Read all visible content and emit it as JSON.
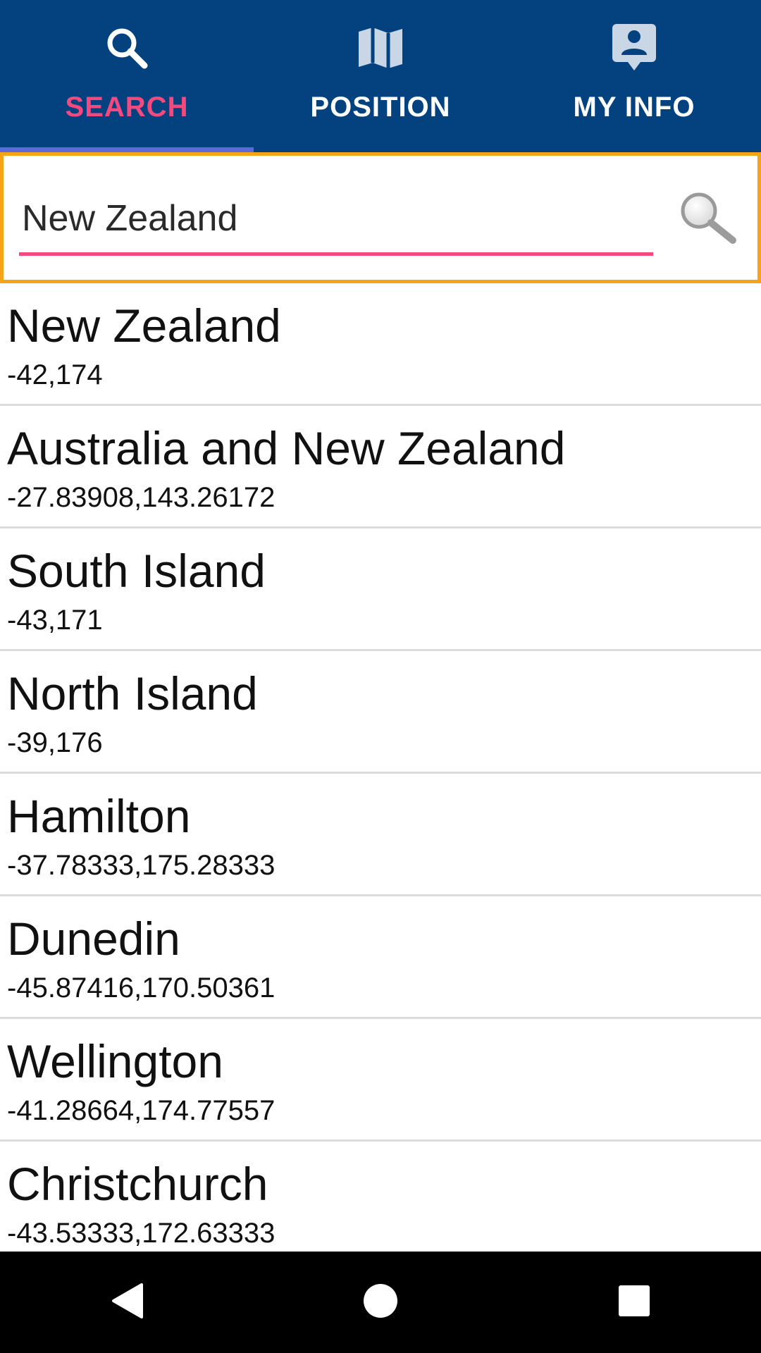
{
  "tabs": [
    {
      "label": "SEARCH",
      "icon": "search-icon",
      "active": true
    },
    {
      "label": "POSITION",
      "icon": "map-icon",
      "active": false
    },
    {
      "label": "MY INFO",
      "icon": "contact-card-icon",
      "active": false
    }
  ],
  "search": {
    "value": "New Zealand",
    "button_icon": "magnifier-icon"
  },
  "results": [
    {
      "name": "New Zealand",
      "coords": "-42,174"
    },
    {
      "name": "Australia and New Zealand",
      "coords": "-27.83908,143.26172"
    },
    {
      "name": "South Island",
      "coords": "-43,171"
    },
    {
      "name": "North Island",
      "coords": "-39,176"
    },
    {
      "name": "Hamilton",
      "coords": "-37.78333,175.28333"
    },
    {
      "name": "Dunedin",
      "coords": "-45.87416,170.50361"
    },
    {
      "name": "Wellington",
      "coords": "-41.28664,174.77557"
    },
    {
      "name": "Christchurch",
      "coords": "-43.53333,172.63333"
    }
  ],
  "navbar": {
    "back_icon": "back-triangle-icon",
    "home_icon": "home-circle-icon",
    "recents_icon": "recents-square-icon"
  },
  "colors": {
    "tab_bar": "#04427f",
    "active_tab_text": "#f2497f",
    "tab_indicator": "#5a6ad8",
    "search_border": "#f6a317",
    "search_underline": "#f2497f"
  }
}
